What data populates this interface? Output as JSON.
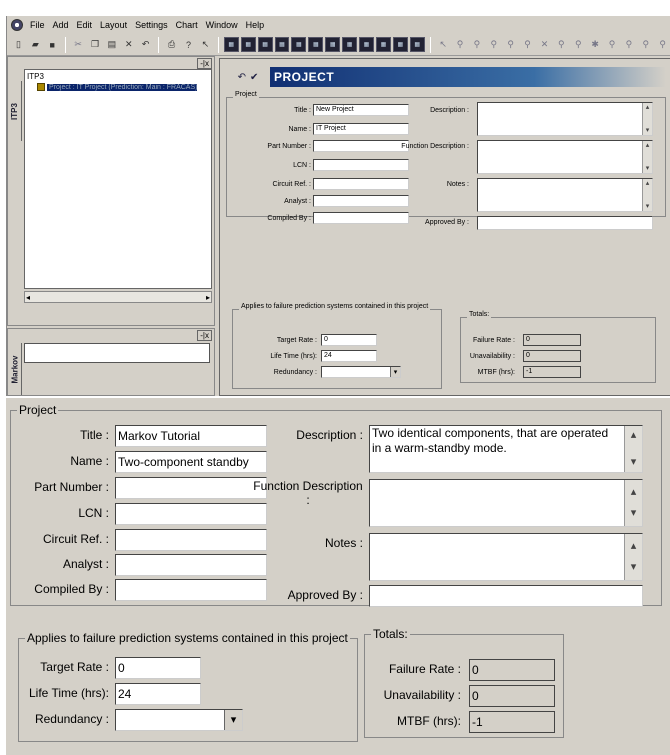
{
  "menu": {
    "items": [
      "File",
      "Add",
      "Edit",
      "Layout",
      "Settings",
      "Chart",
      "Window",
      "Help"
    ]
  },
  "toolbar": {
    "standard_icons": [
      "new-icon",
      "open-icon",
      "save-icon",
      "cut-icon",
      "copy-icon",
      "paste-icon",
      "delete-icon",
      "undo-icon",
      "print-icon",
      "help-icon",
      "context-help-icon"
    ],
    "module_icons_count": 12,
    "drawing_icons_count": 14
  },
  "tree": {
    "side_tab": "ITP3",
    "root": "ITP3",
    "node": "Project : IT Project (Prediction: Main : FRACAS)"
  },
  "markov": {
    "side_tab": "Markov"
  },
  "project_window": {
    "header_title": "PROJECT",
    "group_title": "Project",
    "fields": {
      "title_label": "Title :",
      "title_value": "New Project",
      "name_label": "Name :",
      "name_value": "IT Project",
      "part_number_label": "Part Number :",
      "part_number_value": "",
      "lcn_label": "LCN :",
      "lcn_value": "",
      "circuit_ref_label": "Circuit Ref. :",
      "circuit_ref_value": "",
      "analyst_label": "Analyst :",
      "analyst_value": "",
      "compiled_by_label": "Compiled By :",
      "compiled_by_value": "",
      "description_label": "Description :",
      "description_value": "",
      "function_description_label": "Function Description :",
      "function_description_value": "",
      "notes_label": "Notes :",
      "notes_value": "",
      "approved_by_label": "Approved By :",
      "approved_by_value": ""
    },
    "applies": {
      "group_title": "Applies to failure prediction systems contained in this project",
      "target_rate_label": "Target Rate :",
      "target_rate_value": "0",
      "life_time_label": "Life Time (hrs):",
      "life_time_value": "24",
      "redundancy_label": "Redundancy :",
      "redundancy_value": ""
    },
    "totals": {
      "group_title": "Totals:",
      "failure_rate_label": "Failure Rate :",
      "failure_rate_value": "0",
      "unavailability_label": "Unavailability :",
      "unavailability_value": "0",
      "mtbf_label": "MTBF (hrs):",
      "mtbf_value": "-1"
    }
  },
  "zoom_panel": {
    "group_title": "Project",
    "fields": {
      "title_label": "Title :",
      "title_value": "Markov Tutorial",
      "name_label": "Name :",
      "name_value": "Two-component standby",
      "part_number_label": "Part Number :",
      "part_number_value": "",
      "lcn_label": "LCN :",
      "lcn_value": "",
      "circuit_ref_label": "Circuit Ref. :",
      "circuit_ref_value": "",
      "analyst_label": "Analyst :",
      "analyst_value": "",
      "compiled_by_label": "Compiled By :",
      "compiled_by_value": "",
      "description_label": "Description :",
      "description_value": "Two identical components, that are operated in a warm-standby mode.",
      "function_description_label": "Function Description :",
      "function_description_value": "",
      "notes_label": "Notes :",
      "notes_value": "",
      "approved_by_label": "Approved By :",
      "approved_by_value": ""
    },
    "applies": {
      "group_title": "Applies to failure prediction systems contained in this project",
      "target_rate_label": "Target Rate :",
      "target_rate_value": "0",
      "life_time_label": "Life Time (hrs):",
      "life_time_value": "24",
      "redundancy_label": "Redundancy :",
      "redundancy_value": ""
    },
    "totals": {
      "group_title": "Totals:",
      "failure_rate_label": "Failure Rate :",
      "failure_rate_value": "0",
      "unavailability_label": "Unavailability :",
      "unavailability_value": "0",
      "mtbf_label": "MTBF (hrs):",
      "mtbf_value": "-1"
    }
  }
}
